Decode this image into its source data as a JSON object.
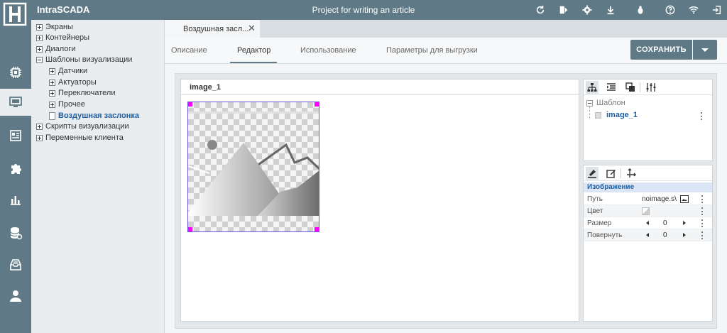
{
  "app": {
    "name": "IntraSCADA",
    "project": "Project for writing an article"
  },
  "colors": {
    "bar": "#5f7a86",
    "accent": "#1f5fa0",
    "selection_handle": "#ff00ff"
  },
  "top_icons": [
    "refresh-icon",
    "toggle-panel-icon",
    "gear-icon",
    "download-icon",
    "bug-icon",
    "help-icon",
    "wifi-icon",
    "logout-icon"
  ],
  "nav": [
    "cpu-icon",
    "monitor-icon",
    "news-icon",
    "puzzle-icon",
    "bar-chart-icon",
    "database-icon",
    "archive-icon",
    "user-icon"
  ],
  "tree": {
    "items": [
      {
        "label": "Экраны"
      },
      {
        "label": "Контейнеры"
      },
      {
        "label": "Диалоги"
      },
      {
        "label": "Шаблоны визуализации"
      },
      {
        "label": "Датчики"
      },
      {
        "label": "Актуаторы"
      },
      {
        "label": "Переключатели"
      },
      {
        "label": "Прочее"
      },
      {
        "label": "Воздушная заслонка"
      },
      {
        "label": "Скрипты визуализации"
      },
      {
        "label": "Переменные клиента"
      }
    ]
  },
  "tab": {
    "label": "Воздушная засл...",
    "close": "✕"
  },
  "subtabs": [
    "Описание",
    "Редактор",
    "Использование",
    "Параметры для выгрузки"
  ],
  "save": {
    "label": "СОХРАНИТЬ"
  },
  "canvas": {
    "title": "image_1"
  },
  "structure": {
    "root": "Шаблон",
    "child": "image_1"
  },
  "properties": {
    "section": "Изображение",
    "rows": [
      {
        "label": "Путь",
        "value": "noimage.s\\"
      },
      {
        "label": "Цвет",
        "value": ""
      },
      {
        "label": "Размер",
        "value": "0"
      },
      {
        "label": "Повернуть",
        "value": "0"
      }
    ]
  }
}
